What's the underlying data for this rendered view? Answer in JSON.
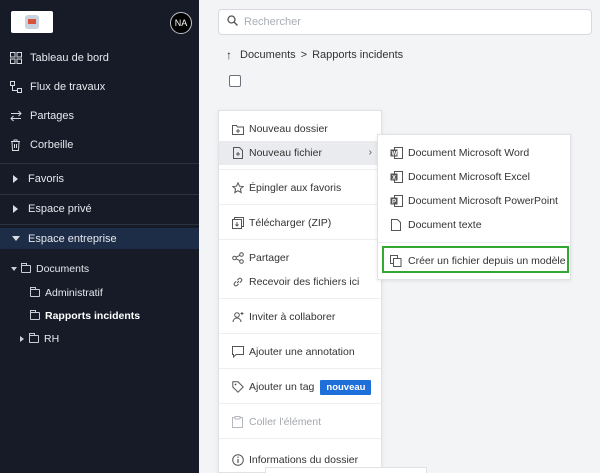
{
  "user": {
    "initials": "NA"
  },
  "nav": {
    "items": [
      {
        "label": "Tableau de bord",
        "icon": "dashboard-icon"
      },
      {
        "label": "Flux de travaux",
        "icon": "workflow-icon"
      },
      {
        "label": "Partages",
        "icon": "share-arrows-icon"
      },
      {
        "label": "Corbeille",
        "icon": "trash-icon"
      }
    ],
    "sections": [
      {
        "label": "Favoris",
        "expanded": false
      },
      {
        "label": "Espace privé",
        "expanded": false
      },
      {
        "label": "Espace entreprise",
        "expanded": true
      }
    ],
    "tree": {
      "root": "Documents",
      "children": [
        "Administratif",
        "Rapports incidents",
        "RH"
      ],
      "selected": "Rapports incidents"
    }
  },
  "search": {
    "placeholder": "Rechercher"
  },
  "breadcrumb": {
    "root": "Documents",
    "current": "Rapports incidents",
    "separator": ">"
  },
  "context_menu": {
    "items": [
      {
        "label": "Nouveau dossier",
        "icon": "folder-plus-icon"
      },
      {
        "label": "Nouveau fichier",
        "icon": "file-plus-icon",
        "has_submenu": true
      },
      {
        "label": "Épingler aux favoris",
        "icon": "star-icon"
      },
      {
        "label": "Télécharger (ZIP)",
        "icon": "download-zip-icon"
      },
      {
        "label": "Partager",
        "icon": "share-icon"
      },
      {
        "label": "Recevoir des fichiers ici",
        "icon": "link-icon"
      },
      {
        "label": "Inviter à collaborer",
        "icon": "user-plus-icon"
      },
      {
        "label": "Ajouter une annotation",
        "icon": "comment-icon"
      },
      {
        "label": "Ajouter un tag",
        "icon": "tag-icon",
        "badge": "nouveau"
      },
      {
        "label": "Coller l'élément",
        "icon": "paste-icon",
        "disabled": true
      },
      {
        "label": "Informations du dossier",
        "icon": "info-icon"
      }
    ]
  },
  "submenu": {
    "items": [
      {
        "label": "Document Microsoft Word",
        "icon": "word-doc-icon"
      },
      {
        "label": "Document Microsoft Excel",
        "icon": "excel-doc-icon"
      },
      {
        "label": "Document Microsoft PowerPoint",
        "icon": "powerpoint-doc-icon"
      },
      {
        "label": "Document texte",
        "icon": "text-doc-icon"
      },
      {
        "label": "Créer un fichier depuis un modèle",
        "icon": "template-icon",
        "highlighted": true
      }
    ]
  },
  "colors": {
    "sidebar_bg": "#161b27",
    "active_bg": "#1e2d47",
    "badge_bg": "#1e6fd9",
    "highlight_border": "#35a833"
  }
}
